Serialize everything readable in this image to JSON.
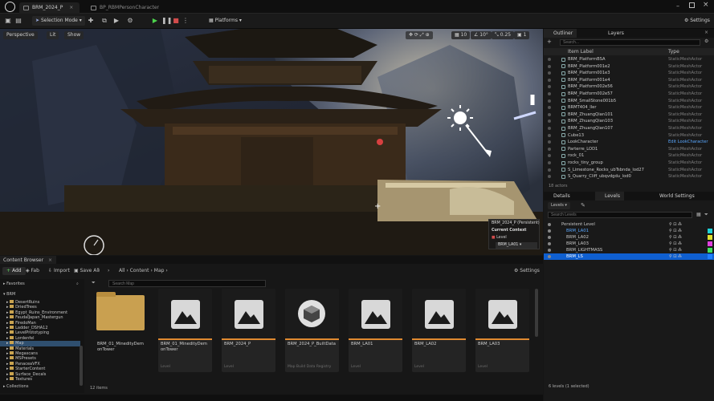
{
  "app": {
    "tabs": [
      "BRM_2024_P",
      "BP_RBMPersonCharacter"
    ],
    "settings_label": "Settings"
  },
  "toolbar": {
    "mode": "Selection Mode",
    "platforms": "Platforms"
  },
  "viewport": {
    "perspective": "Perspective",
    "lit": "Lit",
    "show": "Show",
    "grid_snap": "10",
    "rot_snap": "10°",
    "scale_snap": "0.25",
    "cam_speed": "1",
    "level_popup": {
      "title": "BRM_2024_P (Persistent)",
      "current_context": "Current Context",
      "level_label": "Level",
      "level_value": "BRM_LA01"
    }
  },
  "outliner": {
    "tab_outliner": "Outliner",
    "tab_layers": "Layers",
    "search_placeholder": "Search...",
    "col_item": "Item Label",
    "col_type": "Type",
    "rows": [
      {
        "name": "BRM_PlatformBSA",
        "type": "StaticMeshActor"
      },
      {
        "name": "BRM_Platform001e2",
        "type": "StaticMeshActor"
      },
      {
        "name": "BRM_Platform001e3",
        "type": "StaticMeshActor"
      },
      {
        "name": "BRM_Platform001e4",
        "type": "StaticMeshActor"
      },
      {
        "name": "BRM_Platform002e56",
        "type": "StaticMeshActor"
      },
      {
        "name": "BRM_Platform002e57",
        "type": "StaticMeshActor"
      },
      {
        "name": "BRM_SmallStone001b5",
        "type": "StaticMeshActor"
      },
      {
        "name": "BRMT404_ller",
        "type": "StaticMeshActor"
      },
      {
        "name": "BRM_ZhuangQian101",
        "type": "StaticMeshActor"
      },
      {
        "name": "BRM_ZhuangQian103",
        "type": "StaticMeshActor"
      },
      {
        "name": "BRM_ZhuangQian107",
        "type": "StaticMeshActor"
      },
      {
        "name": "Cube13",
        "type": "StaticMeshActor"
      },
      {
        "name": "LookCharacter",
        "type": "Edit LookCharacter"
      },
      {
        "name": "Parterre_LOD1",
        "type": "StaticMeshActor"
      },
      {
        "name": "rock_01",
        "type": "StaticMeshActor"
      },
      {
        "name": "rocks_tiny_group",
        "type": "StaticMeshActor"
      },
      {
        "name": "S_Limestone_Rocks_ubTsbnda_lod27",
        "type": "StaticMeshActor"
      },
      {
        "name": "S_Quarry_Cliff_ubqvdgdu_lod0",
        "type": "StaticMeshActor"
      }
    ],
    "actor_count": "18 actors"
  },
  "levels": {
    "tab_details": "Details",
    "tab_levels": "Levels",
    "tab_world": "World Settings",
    "levels_btn": "Levels",
    "search_placeholder": "Search Levels",
    "rows": [
      {
        "name": "Persistent Level",
        "color": "#c9c9c9"
      },
      {
        "name": "BRM_LA01",
        "color": "#5aa8ff"
      },
      {
        "name": "BRM_LA02",
        "color": "#c9c9c9"
      },
      {
        "name": "BRM_LA03",
        "color": "#c9c9c9"
      },
      {
        "name": "BRM_LIGHTMASS",
        "color": "#c9c9c9"
      },
      {
        "name": "BRM_LS",
        "color": "#ffffff"
      }
    ],
    "count": "6 levels (1 selected)",
    "swatches": [
      "#1fd0d8",
      "#e0e030",
      "#e040e0",
      "#40e060",
      "#2080ff"
    ]
  },
  "content_browser": {
    "tab": "Content Browser",
    "add": "Add",
    "fab": "Fab",
    "import": "Import",
    "save_all": "Save All",
    "path": [
      "All",
      "Content",
      "Map"
    ],
    "settings": "Settings",
    "search_placeholder": "Search Map",
    "favorites": "Favorites",
    "root": "BRM",
    "tree": [
      "DesertRuins",
      "DriedTrees",
      "Egypt_Ruins_Environment",
      "FeudalJapan_Mastergun",
      "FiredoMan",
      "Ladder_DSHA12",
      "LevelPrototyping",
      "Lordenfel",
      "Map",
      "Materials",
      "Megascans",
      "MSPresets",
      "PanaceaVFX",
      "StarterContent",
      "Surface_Decals",
      "Textures"
    ],
    "assets": [
      {
        "label": "BRM_01_MinedityDemonTower",
        "type": "",
        "kind": "folder"
      },
      {
        "label": "BRM_01_MinedityDemonTower",
        "type": "Level",
        "kind": "level"
      },
      {
        "label": "BRM_2024_P",
        "type": "Level",
        "kind": "level"
      },
      {
        "label": "BRM_2024_P_BuiltData",
        "type": "Map Build Data Registry",
        "kind": "data"
      },
      {
        "label": "BRM_LA01",
        "type": "Level",
        "kind": "level"
      },
      {
        "label": "BRM_LA02",
        "type": "Level",
        "kind": "level"
      },
      {
        "label": "BRM_LA03",
        "type": "Level",
        "kind": "level"
      }
    ],
    "item_count": "12 items",
    "collections": "Collections"
  }
}
